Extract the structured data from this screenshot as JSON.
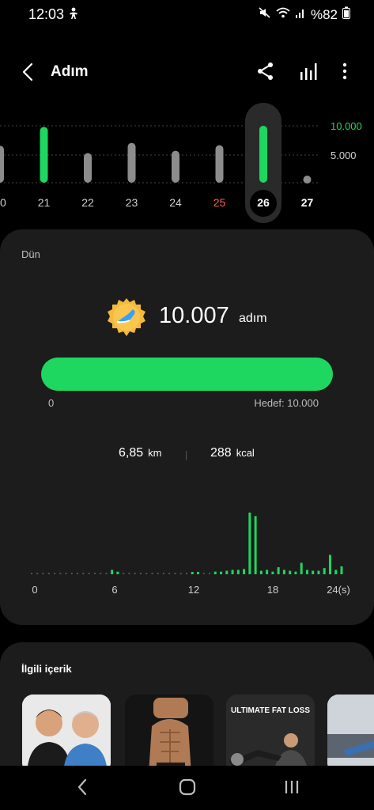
{
  "status_bar": {
    "time": "12:03",
    "battery": "%82"
  },
  "header": {
    "title": "Adım"
  },
  "week_chart": {
    "goal_label": "10.000",
    "mid_label": "5.000",
    "days": [
      {
        "label": "20",
        "value": 6500,
        "color": "#8c8c8c"
      },
      {
        "label": "21",
        "value": 9800,
        "color": "#1ed760"
      },
      {
        "label": "22",
        "value": 5200,
        "color": "#8c8c8c"
      },
      {
        "label": "23",
        "value": 7000,
        "color": "#8c8c8c"
      },
      {
        "label": "24",
        "value": 5600,
        "color": "#8c8c8c"
      },
      {
        "label": "25",
        "value": 6600,
        "color": "#8c8c8c"
      },
      {
        "label": "26",
        "value": 10007,
        "color": "#1ed760"
      },
      {
        "label": "27",
        "value": 0,
        "color": "#8c8c8c"
      }
    ],
    "label_colors": [
      "#cfcfcf",
      "#cfcfcf",
      "#cfcfcf",
      "#cfcfcf",
      "#cfcfcf",
      "#ff5a5a",
      "#ffffff",
      "#ffffff"
    ],
    "selected_day": "26"
  },
  "summary": {
    "day_label": "Dün",
    "steps": "10.007",
    "steps_unit": "adım",
    "progress_min": "0",
    "goal_text": "Hedef: 10.000",
    "progress_fraction": 1.0,
    "distance": "6,85",
    "distance_unit": "km",
    "calories": "288",
    "calories_unit": "kcal",
    "accent_color": "#1ed760"
  },
  "hourly_chart": {
    "x_ticks": [
      "0",
      "6",
      "12",
      "18",
      "24(s)"
    ],
    "values": [
      0,
      0,
      0,
      0,
      0,
      0,
      0,
      0,
      0,
      0,
      0,
      0,
      0,
      0,
      5,
      3,
      0,
      0,
      0,
      0,
      0,
      0,
      0,
      0,
      0,
      0,
      0,
      0,
      2,
      2,
      0,
      0,
      3,
      3,
      4,
      5,
      5,
      6,
      70,
      66,
      4,
      5,
      3,
      8,
      5,
      4,
      3,
      13,
      5,
      4,
      4,
      7,
      22,
      5,
      9
    ]
  },
  "related": {
    "title": "İlgili içerik",
    "thumb3_text": "ULTIMATE FAT LOSS"
  }
}
